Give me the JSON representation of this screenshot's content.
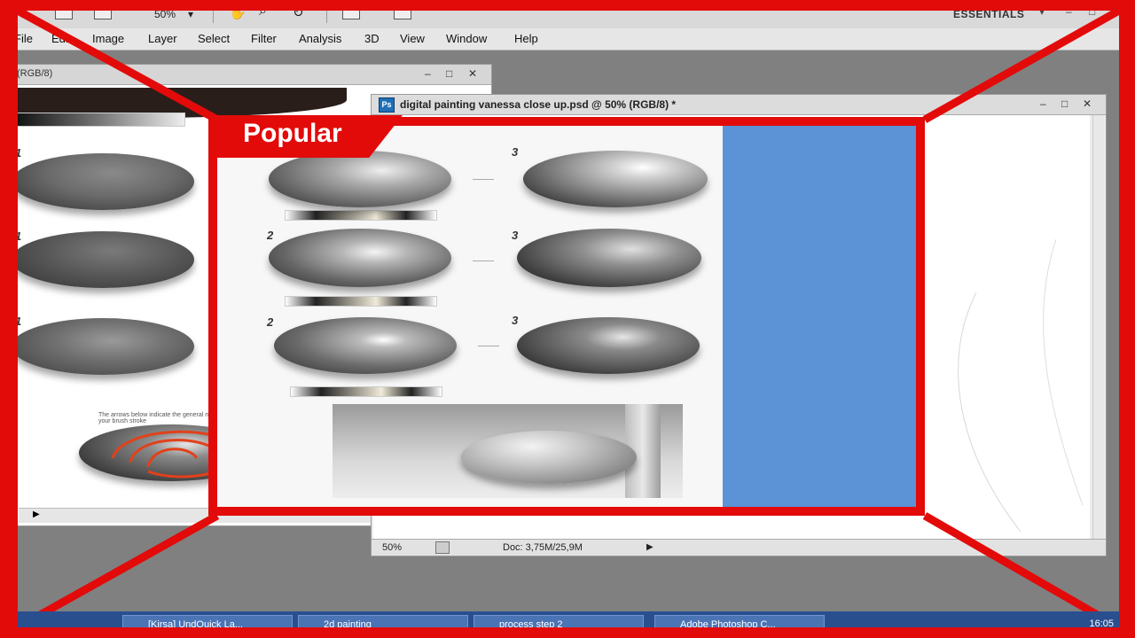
{
  "option_bar": {
    "zoom": "50%",
    "workspace": "ESSENTIALS",
    "min": "–",
    "restore": "□"
  },
  "menu": [
    "File",
    "Edit",
    "Image",
    "Layer",
    "Select",
    "Filter",
    "Analysis",
    "3D",
    "View",
    "Window",
    "Help"
  ],
  "left_window": {
    "title": "(RGB/8)",
    "minimize": "–",
    "maximize": "□",
    "close": "✕"
  },
  "main_window": {
    "title": "digital painting vanessa close up.psd @ 50% (RGB/8) *",
    "icon_label": "Ps",
    "minimize": "–",
    "maximize": "□",
    "close": "✕",
    "status": {
      "zoom": "50%",
      "doc": "Doc: 3,75M/25,9M"
    }
  },
  "canvas": {
    "steps": {
      "one": "1",
      "two": "2",
      "three": "3"
    },
    "note": "The arrows below indicate the general motion of your brush stroke"
  },
  "overlay": {
    "badge": "Popular",
    "frame_color": "#e30a0a",
    "panel_color": "#5b93d6"
  },
  "taskbar": {
    "tasks": [
      "[Kirsa] UndQuick La...",
      "2d painting",
      "process step 2",
      "Adobe Photoshop C..."
    ],
    "clock": "16:05"
  }
}
